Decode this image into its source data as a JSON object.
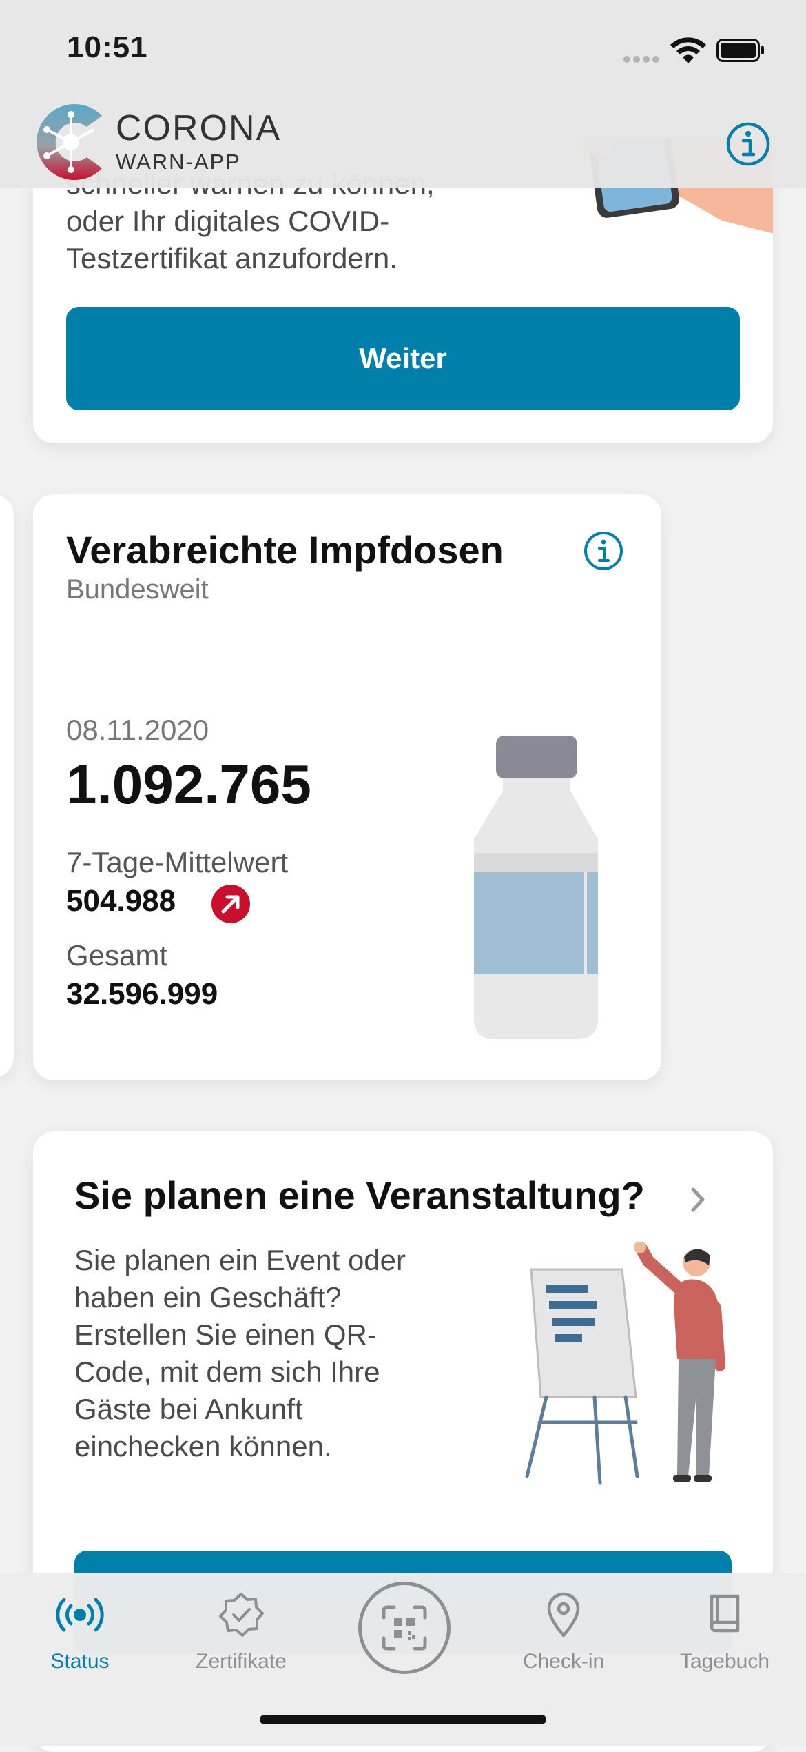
{
  "status_bar": {
    "time": "10:51"
  },
  "header": {
    "brand": "CORONA",
    "brand_sub": "WARN-APP",
    "info_icon": "info-icon"
  },
  "card_intro": {
    "text_lines": [
      "schneller warnen zu können,",
      "oder Ihr digitales COVID-",
      "Testzertifikat anzufordern."
    ],
    "button_label": "Weiter"
  },
  "vaccination_card": {
    "title": "Verabreichte Impfdosen",
    "subtitle": "Bundesweit",
    "date": "08.11.2020",
    "value": "1.092.765",
    "avg_label": "7-Tage-Mittelwert",
    "avg_value": "504.988",
    "trend": "up",
    "total_label": "Gesamt",
    "total_value": "32.596.999"
  },
  "event_card": {
    "title": "Sie planen eine Veranstaltung?",
    "text_lines": [
      "Sie planen ein Event oder",
      "haben ein Geschäft?",
      "Erstellen Sie einen QR-",
      "Code, mit dem sich Ihre",
      "Gäste bei Ankunft",
      "einchecken können."
    ]
  },
  "tabs": [
    {
      "label": "Status",
      "icon": "broadcast-icon",
      "active": true
    },
    {
      "label": "Zertifikate",
      "icon": "certificate-icon",
      "active": false
    },
    {
      "label": "",
      "icon": "qr-scan-icon",
      "active": false
    },
    {
      "label": "Check-in",
      "icon": "location-pin-icon",
      "active": false
    },
    {
      "label": "Tagebuch",
      "icon": "book-icon",
      "active": false
    }
  ],
  "colors": {
    "accent": "#007faa",
    "trend_up": "#c8102e",
    "logo_red": "#c8102e"
  }
}
